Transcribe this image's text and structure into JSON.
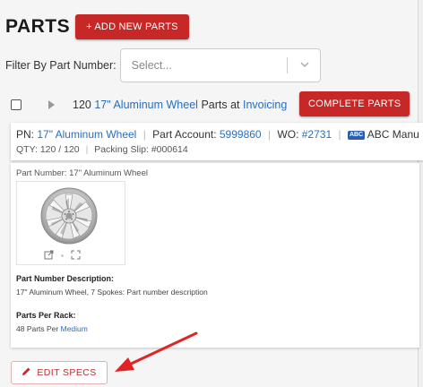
{
  "header": {
    "title": "PARTS",
    "add_button": "+ ADD NEW PARTS"
  },
  "filter": {
    "label": "Filter By Part Number:",
    "placeholder": "Select..."
  },
  "group": {
    "count": "120",
    "part_name": "17\" Aluminum Wheel",
    "mid_text": "Parts at",
    "location": "Invoicing",
    "complete_button": "COMPLETE PARTS"
  },
  "part_card": {
    "pn_label": "PN:",
    "pn_value": "17\" Aluminum Wheel",
    "account_label": "Part Account:",
    "account_value": "5999860",
    "wo_label": "WO:",
    "wo_value": "#2731",
    "customer_logo": "ABC",
    "customer": "ABC Manu",
    "qty": "QTY: 120 / 120",
    "packing_slip": "Packing Slip: #000614"
  },
  "spec": {
    "part_number_title": "Part Number: 17\" Aluminum Wheel",
    "description_label": "Part Number Description:",
    "description_value": "17\" Aluminum Wheel, 7 Spokes: Part number description",
    "per_rack_label": "Parts Per Rack:",
    "per_rack_prefix": "48 Parts Per",
    "per_rack_size": "Medium"
  },
  "edit_button": "EDIT SPECS",
  "colors": {
    "accent": "#c62828",
    "link": "#2a6ebb"
  }
}
